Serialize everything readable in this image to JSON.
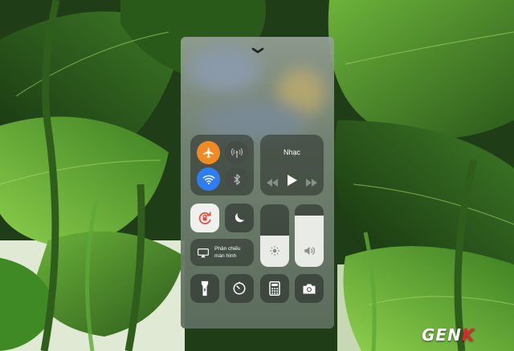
{
  "control_center": {
    "music": {
      "title": "Nhạc"
    },
    "screen_mirroring": {
      "line1": "Phản chiếu",
      "line2": "màn hình"
    },
    "brightness_level": 0.5,
    "volume_level": 0.82,
    "toggles": {
      "airplane_mode": {
        "icon": "airplane-icon",
        "on": true,
        "color": "#f08a24"
      },
      "cellular_data": {
        "icon": "antenna-icon",
        "on": false
      },
      "wifi": {
        "icon": "wifi-icon",
        "on": true,
        "color": "#2f7df6"
      },
      "bluetooth": {
        "icon": "bluetooth-icon",
        "on": false
      },
      "rotation_lock": {
        "icon": "rotation-lock-icon",
        "on": true,
        "color": "#e8463d"
      },
      "do_not_disturb": {
        "icon": "moon-icon",
        "on": false
      }
    },
    "shortcuts": [
      "flashlight-icon",
      "timer-icon",
      "calculator-icon",
      "camera-icon"
    ]
  },
  "watermark": {
    "text_main": "GEN",
    "text_accent": "K"
  }
}
